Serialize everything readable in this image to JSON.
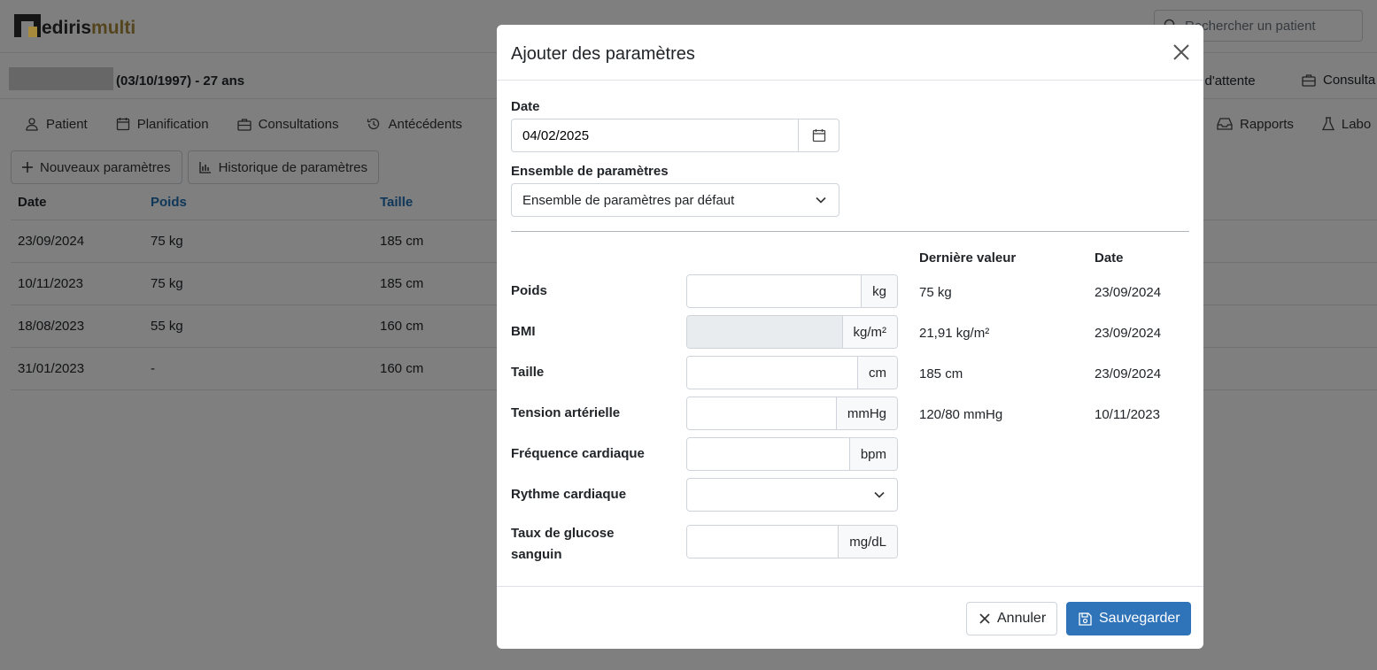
{
  "app": {
    "logo_prefix": "ediris",
    "logo_suffix": "multi",
    "search_placeholder": "Rechercher un patient",
    "patient_info": "(03/10/1997) - 27 ans",
    "waiting_link": "e d'attente",
    "consult_link": "Consulta",
    "nav_tabs": [
      "Patient",
      "Planification",
      "Consultations",
      "Antécédents"
    ],
    "nav_right": [
      "Rapports",
      "Labo"
    ],
    "buttons": {
      "new_params": "Nouveaux paramètres",
      "history": "Historique de paramètres"
    },
    "table": {
      "headers": [
        "Date",
        "Poids",
        "Taille"
      ],
      "rows": [
        [
          "23/09/2024",
          "75 kg",
          "185 cm"
        ],
        [
          "10/11/2023",
          "75 kg",
          "185 cm"
        ],
        [
          "18/08/2023",
          "55 kg",
          "160 cm"
        ],
        [
          "31/01/2023",
          "-",
          "160 cm"
        ]
      ]
    }
  },
  "modal": {
    "title": "Ajouter des paramètres",
    "date_label": "Date",
    "date_value": "04/02/2025",
    "set_label": "Ensemble de paramètres",
    "set_value": "Ensemble de paramètres par défaut",
    "col_last_value": "Dernière valeur",
    "col_date": "Date",
    "params": [
      {
        "label": "Poids",
        "unit": "kg",
        "last": "75 kg",
        "date": "23/09/2024",
        "value": ""
      },
      {
        "label": "BMI",
        "unit": "kg/m²",
        "last": "21,91 kg/m²",
        "date": "23/09/2024",
        "value": ""
      },
      {
        "label": "Taille",
        "unit": "cm",
        "last": "185 cm",
        "date": "23/09/2024",
        "value": ""
      },
      {
        "label": "Tension artérielle",
        "unit": "mmHg",
        "last": "120/80 mmHg",
        "date": "10/11/2023",
        "value": ""
      },
      {
        "label": "Fréquence cardiaque",
        "unit": "bpm",
        "last": "",
        "date": "",
        "value": ""
      },
      {
        "label": "Rythme cardiaque",
        "unit": "",
        "last": "",
        "date": "",
        "value": ""
      },
      {
        "label": "Taux de glucose",
        "label_line2": "sanguin",
        "unit": "mg/dL",
        "last": "",
        "date": "",
        "value": ""
      }
    ],
    "cancel_label": "Annuler",
    "save_label": "Sauvegarder"
  },
  "colors": {
    "primary": "#2f73b8",
    "link": "#1f6fb2",
    "brand_gold": "#a88a3c"
  }
}
